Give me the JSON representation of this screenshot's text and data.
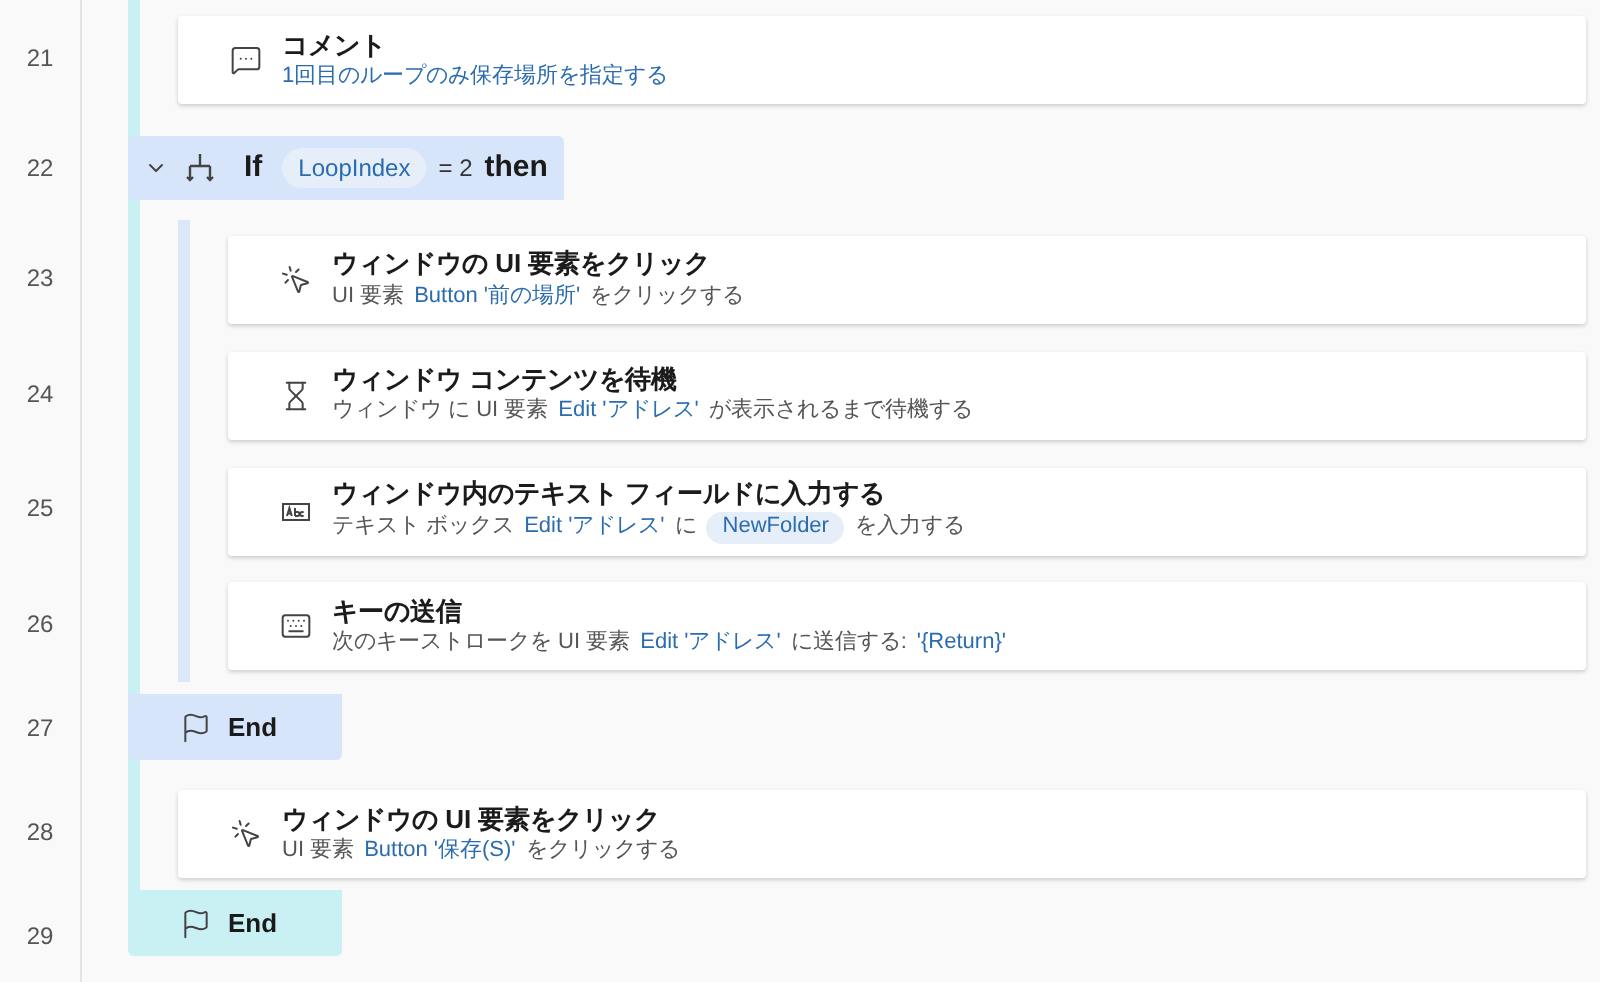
{
  "block": {
    "steps": [
      {
        "line": "21",
        "kind": "comment",
        "title": "コメント",
        "desc": [
          {
            "kind": "ref",
            "text": "1回目のループのみ保存場所を指定する"
          }
        ]
      },
      {
        "line": "22",
        "kind": "if",
        "expanded": true,
        "title": "If",
        "condition": [
          {
            "kind": "chip",
            "text": "LoopIndex"
          },
          {
            "kind": "plain",
            "text": "= 2"
          },
          {
            "kind": "bold",
            "text": "then"
          }
        ],
        "children": [
          {
            "line": "23",
            "kind": "click",
            "title": "ウィンドウの UI 要素をクリック",
            "desc": [
              {
                "kind": "plain",
                "text": "UI 要素"
              },
              {
                "kind": "ref",
                "text": "Button '前の場所'"
              },
              {
                "kind": "plain",
                "text": "をクリックする"
              }
            ]
          },
          {
            "line": "24",
            "kind": "wait",
            "title": "ウィンドウ コンテンツを待機",
            "desc": [
              {
                "kind": "plain",
                "text": "ウィンドウ  に UI 要素"
              },
              {
                "kind": "ref",
                "text": "Edit 'アドレス'"
              },
              {
                "kind": "plain",
                "text": "が表示されるまで待機する"
              }
            ]
          },
          {
            "line": "25",
            "kind": "input",
            "title": "ウィンドウ内のテキスト フィールドに入力する",
            "desc": [
              {
                "kind": "plain",
                "text": "テキスト ボックス"
              },
              {
                "kind": "ref",
                "text": "Edit 'アドレス'"
              },
              {
                "kind": "plain",
                "text": "に"
              },
              {
                "kind": "chip",
                "text": "NewFolder"
              },
              {
                "kind": "plain",
                "text": "を入力する"
              }
            ]
          },
          {
            "line": "26",
            "kind": "keys",
            "title": "キーの送信",
            "desc": [
              {
                "kind": "plain",
                "text": "次のキーストロークを UI 要素"
              },
              {
                "kind": "ref",
                "text": "Edit 'アドレス'"
              },
              {
                "kind": "plain",
                "text": "に送信する:"
              },
              {
                "kind": "ref",
                "text": "'{Return}'"
              }
            ]
          }
        ],
        "end": {
          "line": "27",
          "kind": "if",
          "label": "End"
        }
      },
      {
        "line": "28",
        "kind": "click",
        "title": "ウィンドウの UI 要素をクリック",
        "desc": [
          {
            "kind": "plain",
            "text": "UI 要素"
          },
          {
            "kind": "ref",
            "text": "Button '保存(S)'"
          },
          {
            "kind": "plain",
            "text": "をクリックする"
          }
        ]
      }
    ],
    "end": {
      "line": "29",
      "kind": "loop",
      "label": "End"
    }
  }
}
